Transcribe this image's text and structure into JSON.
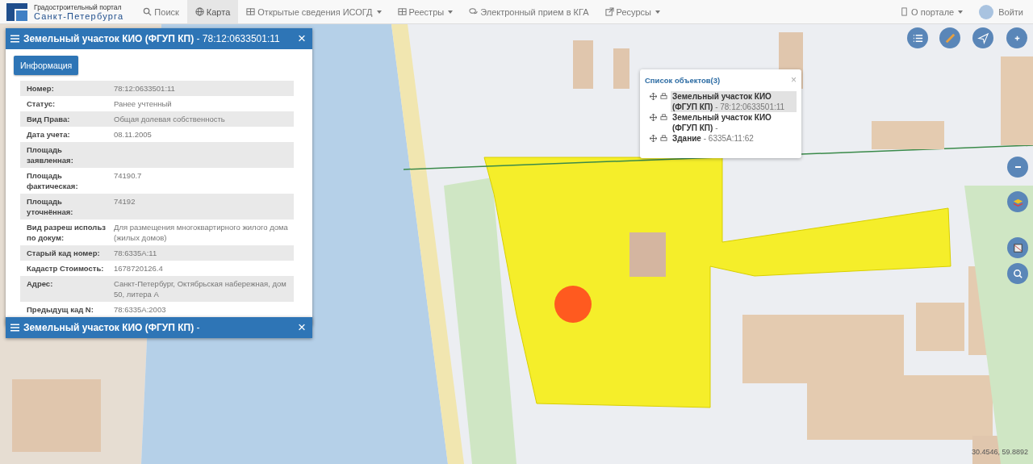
{
  "header": {
    "logo_line1": "Градостроительный портал",
    "logo_line2": "Санкт-Петербурга",
    "nav": [
      {
        "label": "Поиск",
        "kind": "search",
        "dropdown": false,
        "selected": false
      },
      {
        "label": "Карта",
        "kind": "globe",
        "dropdown": false,
        "selected": true
      },
      {
        "label": "Открытые сведения ИСОГД",
        "kind": "grid",
        "dropdown": true,
        "selected": false
      },
      {
        "label": "Реестры",
        "kind": "grid",
        "dropdown": true,
        "selected": false
      },
      {
        "label": "Электронный прием в КГА",
        "kind": "chat",
        "dropdown": false,
        "selected": false
      },
      {
        "label": "Ресурсы",
        "kind": "link",
        "dropdown": true,
        "selected": false
      }
    ],
    "about": {
      "label": "О портале",
      "dropdown": true
    },
    "login": "Войти"
  },
  "panels": [
    {
      "title": "Земельный участок КИО (ФГУП КП)",
      "subtitle": "- 78:12:0633501:11",
      "expanded": true,
      "close": "×",
      "button": "Информация",
      "rows": [
        {
          "label": "Номер:",
          "value": "78:12:0633501:11"
        },
        {
          "label": "Статус:",
          "value": "Ранее учтенный"
        },
        {
          "label": "Вид Права:",
          "value": "Общая долевая собственность"
        },
        {
          "label": "Дата учета:",
          "value": "08.11.2005"
        },
        {
          "label": "Площадь заявленная:"
        },
        {
          "label": "Площадь фактическая:",
          "value": "74190.7"
        },
        {
          "label": "Площадь уточнённая:",
          "value": "74192"
        },
        {
          "label": "Вид разреш использ по докум:",
          "value": "Для размещения многоквартирного жилого дома (жилых домов)"
        },
        {
          "label": "Старый кад номер:",
          "value": "78:6335А:11"
        },
        {
          "label": "Кадастр Стоимость:",
          "value": "1678720126.4"
        },
        {
          "label": "Адрес:",
          "value": "Санкт-Петербург, Октябрьская набережная, дом 50, литера А"
        },
        {
          "label": "Предыдущ кад N:",
          "value": "78:6335А:2003"
        }
      ]
    },
    {
      "title": "Земельный участок КИО (ФГУП КП)",
      "subtitle": "-",
      "expanded": false,
      "close": "×"
    }
  ],
  "popup": {
    "title": "Список объектов(3)",
    "close": "×",
    "items": [
      {
        "title": "Земельный участок КИО (ФГУП КП)",
        "detail": "- 78:12:0633501:11",
        "selected": true
      },
      {
        "title": "Земельный участок КИО (ФГУП КП)",
        "detail": "-",
        "selected": false
      },
      {
        "title": "Здание",
        "detail": "- 6335А:11:62",
        "selected": false
      }
    ]
  },
  "coordinates": "30.4546, 59.8892"
}
